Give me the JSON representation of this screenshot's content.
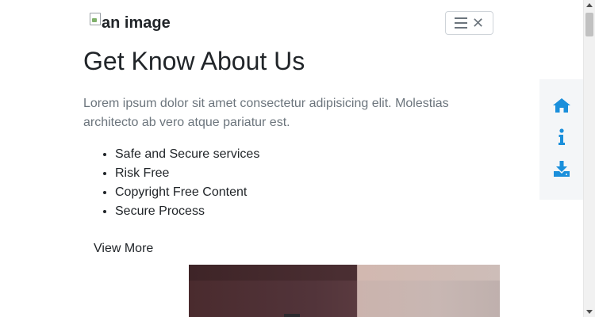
{
  "header": {
    "logo_alt": "an image"
  },
  "about": {
    "title": "Get Know About Us",
    "description": "Lorem ipsum dolor sit amet consectetur adipisicing elit. Molestias architecto ab vero atque pariatur est.",
    "features": [
      "Safe and Secure services",
      "Risk Free",
      "Copyright Free Content",
      "Secure Process"
    ],
    "view_more_label": "View More"
  },
  "side_nav": {
    "items": [
      "home-icon",
      "info-icon",
      "download-icon"
    ],
    "icon_color": "#1a8fdb"
  },
  "colors": {
    "text": "#212529",
    "muted": "#6c757d"
  }
}
